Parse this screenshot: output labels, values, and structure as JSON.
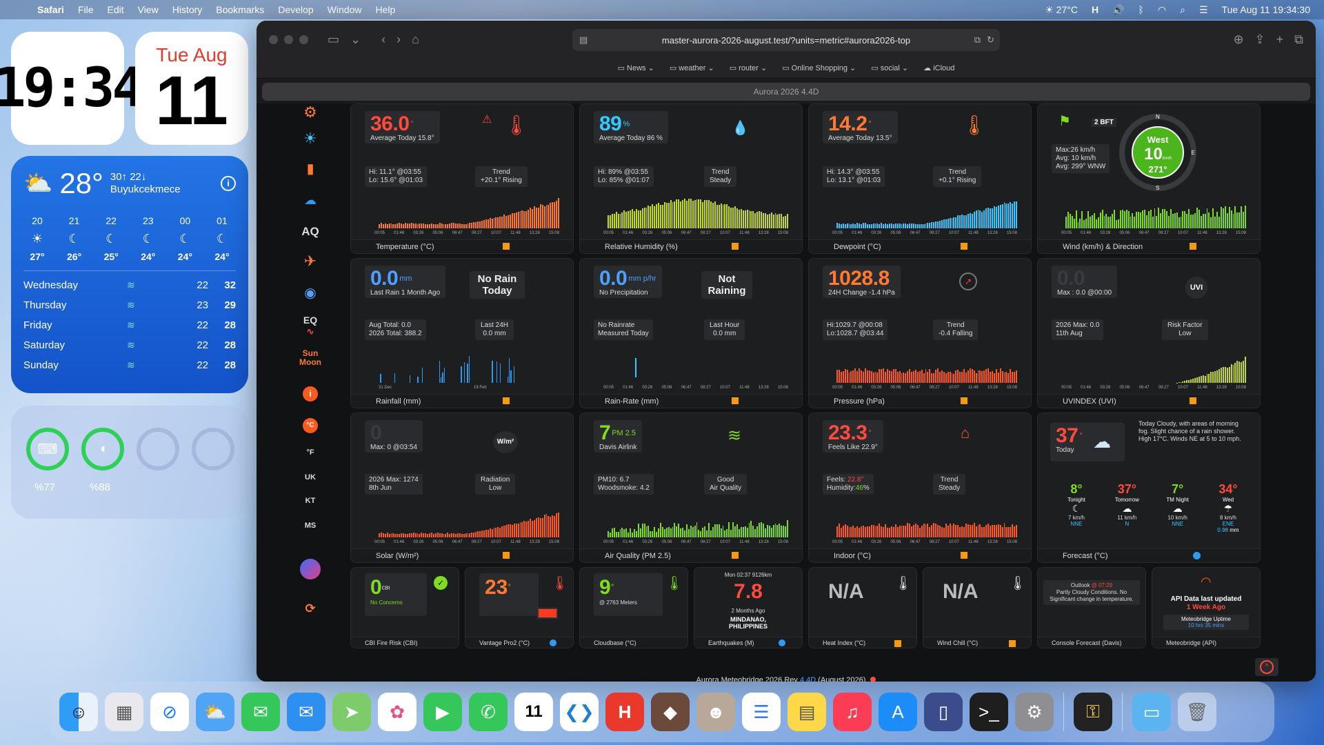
{
  "menubar": {
    "app": "Safari",
    "items": [
      "File",
      "Edit",
      "View",
      "History",
      "Bookmarks",
      "Develop",
      "Window",
      "Help"
    ],
    "temp": "27°C",
    "datetime": "Tue Aug 11  19:34:30"
  },
  "widgets": {
    "clock": "19:34",
    "cal_dow": "Tue Aug",
    "cal_day": "11",
    "weather": {
      "temp": "28°",
      "hilo": "30↑ 22↓",
      "city": "Buyukcekmece",
      "hours": [
        {
          "h": "20",
          "icon": "☀",
          "t": "27°"
        },
        {
          "h": "21",
          "icon": "☾",
          "t": "26°"
        },
        {
          "h": "22",
          "icon": "☾",
          "t": "25°"
        },
        {
          "h": "23",
          "icon": "☾",
          "t": "24°"
        },
        {
          "h": "00",
          "icon": "☾",
          "t": "24°"
        },
        {
          "h": "01",
          "icon": "☾",
          "t": "24°"
        }
      ],
      "days": [
        {
          "d": "Wednesday",
          "lo": "22",
          "hi": "32"
        },
        {
          "d": "Thursday",
          "lo": "23",
          "hi": "29"
        },
        {
          "d": "Friday",
          "lo": "22",
          "hi": "28"
        },
        {
          "d": "Saturday",
          "lo": "22",
          "hi": "28"
        },
        {
          "d": "Sunday",
          "lo": "22",
          "hi": "28"
        }
      ]
    },
    "battery": {
      "keyboard": "%77",
      "mouse": "%88",
      "keyboard_level": 77,
      "mouse_level": 88
    }
  },
  "safari": {
    "url": "master-aurora-2026-august.test/?units=metric#aurora2026-top",
    "bookmarks": [
      "News",
      "weather",
      "router",
      "Online Shopping",
      "social",
      "iCloud"
    ],
    "tab": "Aurora 2026 4.4D"
  },
  "nav": {
    "aq": "AQ",
    "eq": "EQ",
    "sun": "Sun",
    "moon": "Moon",
    "c": "°C",
    "f": "°F",
    "uk": "UK",
    "kt": "KT",
    "ms": "MS"
  },
  "tiles": {
    "temp": {
      "value": "36.0",
      "unit": "°",
      "sub": "Average Today 15.8°",
      "hilo": "Hi: 11.1° @03:55",
      "lo": "Lo: 15.6° @01:03",
      "trend": "Trend",
      "trend_val": "+20.1° Rising",
      "title": "Temperature (°C)"
    },
    "hum": {
      "value": "89",
      "unit": "%",
      "sub": "Average Today 86 %",
      "hilo": "Hi: 89% @03:55",
      "lo": "Lo: 85% @01:07",
      "trend": "Trend",
      "trend_val": "Steady",
      "title": "Relative Humidity (%)"
    },
    "dew": {
      "value": "14.2",
      "unit": "°",
      "sub": "Average Today 13.5°",
      "hilo": "Hi: 14.3° @03:55",
      "lo": "Lo: 13.1° @01:03",
      "trend": "Trend",
      "trend_val": "+0.1° Rising",
      "title": "Dewpoint (°C)"
    },
    "wind": {
      "bft": "2 BFT",
      "max": "Max:26 km/h",
      "avg": "Avg: 10 km/h",
      "avgdir": "Avg: 299° WNW",
      "dir": "West",
      "speed": "10",
      "sunit": "km/h",
      "deg": "271°",
      "n": "N",
      "s": "S",
      "e": "E",
      "title": "Wind (km/h) & Direction"
    },
    "rain": {
      "value": "0.0",
      "unit": "mm",
      "sub": "Last Rain 1 Month Ago",
      "status": "No Rain Today",
      "total1": "Aug Total: 0.0",
      "total2": "2026 Total: 388.2",
      "last": "Last 24H",
      "last_val": "0.0 mm",
      "d1": "31 Dec",
      "d2": "19 Feb",
      "title": "Rainfall (mm)"
    },
    "rrate": {
      "value": "0.0",
      "unit": "mm p/hr",
      "sub": "No Precipitation",
      "status": "Not Raining",
      "note1": "No Rainrate",
      "note2": "Measured Today",
      "last": "Last Hour",
      "last_val": "0.0 mm",
      "title": "Rain-Rate (mm)"
    },
    "press": {
      "value": "1028.8",
      "sub": "24H Change -1.4 hPa",
      "hi": "Hi:1029.7 @00:08",
      "lo": "Lo:1028.7 @03:44",
      "trend": "Trend",
      "trend_val": "-0.4 Falling",
      "title": "Pressure (hPa)"
    },
    "uv": {
      "value": "0.0",
      "sub": "Max : 0.0 @00:00",
      "badge": "UVI",
      "max1": "2026 Max: 0.0",
      "max2": "11th Aug",
      "risk": "Risk Factor",
      "risk_val": "Low",
      "title": "UVINDEX (UVI)"
    },
    "solar": {
      "value": "0",
      "sub": "Max: 0 @03:54",
      "badge": "W/m²",
      "max1": "2026 Max: 1274",
      "max2": "8th Jun",
      "rad": "Radiation",
      "rad_val": "Low",
      "title": "Solar (W/m²)"
    },
    "aq": {
      "value": "7",
      "unit": "PM 2.5",
      "sub": "Davis Airlink",
      "pm10": "PM10: 6.7",
      "smoke": "Woodsmoke: 4.2",
      "good": "Good",
      "good2": "Air Quality",
      "title": "Air Quality (PM 2.5)"
    },
    "indoor": {
      "value": "23.3",
      "unit": "°",
      "sub": "Feels Like 22.9°",
      "feels": "Feels: ",
      "feels_v": "22.8°",
      "hum": "Humidity:",
      "hum_v": "46",
      "hum_u": "%",
      "trend": "Trend",
      "trend_val": "Steady",
      "title": "Indoor (°C)"
    },
    "fc": {
      "value": "37",
      "unit": "°",
      "today": "Today",
      "text": "Today Cloudy, with areas of morning fog. Slight chance of a rain shower. High 17°C. Winds NE at 5 to 10 mph.",
      "cols": [
        {
          "t": "8°",
          "n": "Tonight",
          "w": "7 km/h",
          "d": "NNE",
          "c": "#7fdc1e"
        },
        {
          "t": "37°",
          "n": "Tomorrow",
          "w": "11 km/h",
          "d": "N",
          "c": "#ff4a3c"
        },
        {
          "t": "7°",
          "n": "TM Night",
          "w": "10 km/h",
          "d": "NNE",
          "c": "#7fdc1e"
        },
        {
          "t": "34°",
          "n": "Wed",
          "w": "8 km/h",
          "d": "ENE",
          "c": "#ff4a3c"
        }
      ],
      "rain": "0.98",
      "rain_u": "mm",
      "title": "Forecast (°C)"
    },
    "cbi": {
      "value": "0",
      "unit": "CBI",
      "sub": "No Concerns",
      "title": "CBI Fire Risk (CBI)"
    },
    "vant": {
      "value": "23",
      "unit": "°",
      "title": "Vantage Pro2 (°C)"
    },
    "cloud": {
      "value": "9",
      "unit": "°",
      "sub": "@ 2763 Meters",
      "title": "Cloudbase (°C)"
    },
    "eq": {
      "top": "Mon 02:37 9126km",
      "value": "7.8",
      "ago": "2 Months Ago",
      "place1": "MINDANAO,",
      "place2": "PHILIPPINES",
      "title": "Earthquakes (M)"
    },
    "heat": {
      "value": "N/A",
      "title": "Heat Index (°C)"
    },
    "chill": {
      "value": "N/A",
      "title": "Wind Chill (°C)"
    },
    "console": {
      "label": "Outlook",
      "time": "@ 07:29",
      "text": "Partly Cloudy Conditions. No Significant change in temperature.",
      "title": "Console Forecast (Davis)"
    },
    "api": {
      "text1": "API Data last updated",
      "text2": "1 Week Ago",
      "up": "Meteobridge Uptime",
      "up_v": "10 hrs 35 mins",
      "title": "Meteobridge (API)"
    }
  },
  "footer": {
    "text": "Aurora Meteobridge 2026 Rev ",
    "rev": "4.4D",
    "date": " (August 2026)"
  },
  "axis_times": [
    "00:05",
    "01:46",
    "03:26",
    "05:06",
    "06:47",
    "08:27",
    "10:07",
    "11:48",
    "13:28",
    "15:08"
  ],
  "colors": {
    "accent": "#ff7a2e",
    "green": "#7fdc1e",
    "cyan": "#36c8ff",
    "red": "#ff4a3c"
  }
}
